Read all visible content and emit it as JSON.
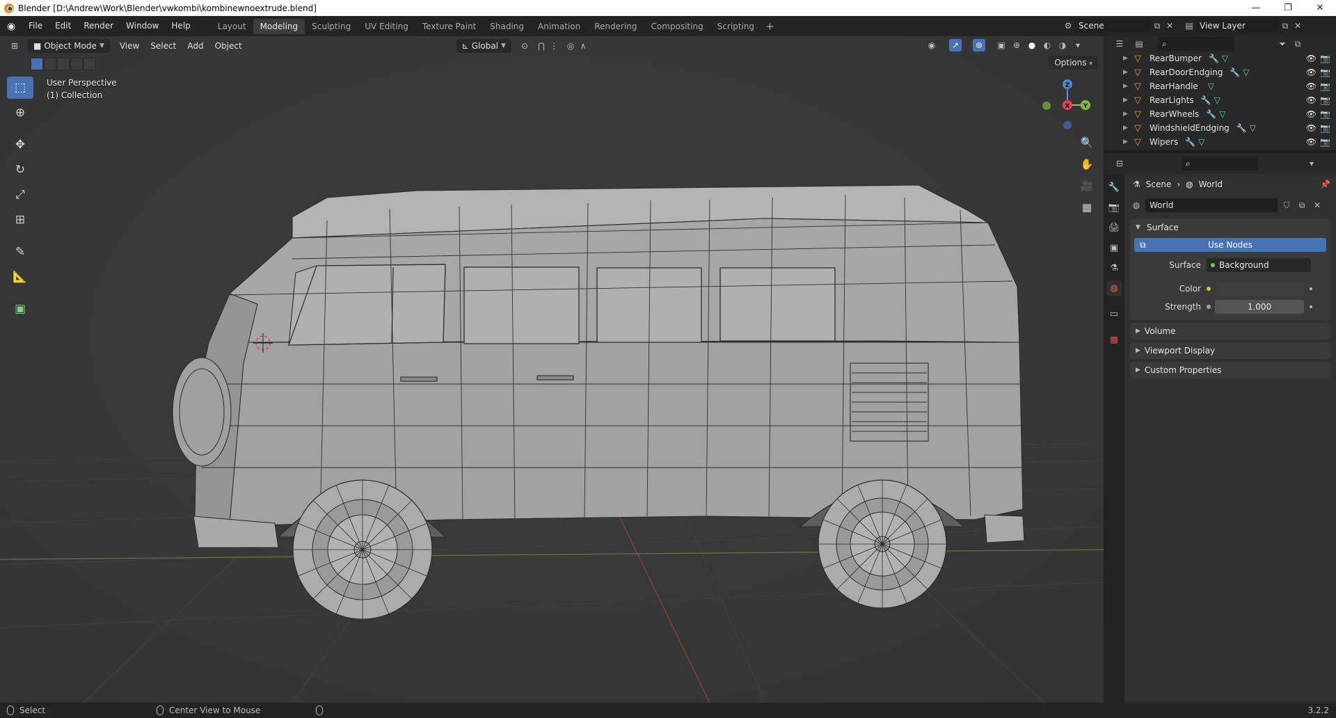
{
  "window": {
    "title": "Blender [D:\\Andrew\\Work\\Blender\\vwkombi\\kombinewnoextrude.blend]",
    "controls": [
      "—",
      "❐",
      "✕"
    ]
  },
  "topbar": {
    "menus": [
      "File",
      "Edit",
      "Render",
      "Window",
      "Help"
    ],
    "workspaces": [
      "Layout",
      "Modeling",
      "Sculpting",
      "UV Editing",
      "Texture Paint",
      "Shading",
      "Animation",
      "Rendering",
      "Compositing",
      "Scripting"
    ],
    "active_workspace": "Modeling",
    "add_tab": "+",
    "scene": "Scene",
    "view_layer": "View Layer"
  },
  "viewport": {
    "mode": "Object Mode",
    "menus": [
      "View",
      "Select",
      "Add",
      "Object"
    ],
    "transform_orientation": "Global",
    "options_label": "Options",
    "overlay_line1": "User Perspective",
    "overlay_line2": "(1) Collection",
    "gizmo_axes": {
      "x": "X",
      "y": "Y",
      "z": "Z"
    }
  },
  "outliner": {
    "rows": [
      {
        "name": "RearBumper"
      },
      {
        "name": "RearDoorEndging"
      },
      {
        "name": "RearHandle"
      },
      {
        "name": "RearLights"
      },
      {
        "name": "RearWheels"
      },
      {
        "name": "WindshieldEndging"
      },
      {
        "name": "Wipers"
      }
    ]
  },
  "properties": {
    "breadcrumb_scene": "Scene",
    "breadcrumb_world": "World",
    "world_name": "World",
    "surface_panel": "Surface",
    "use_nodes": "Use Nodes",
    "surface_label": "Surface",
    "surface_value": "Background",
    "color_label": "Color",
    "strength_label": "Strength",
    "strength_value": "1.000",
    "closed_panels": [
      "Volume",
      "Viewport Display",
      "Custom Properties"
    ],
    "colors": {
      "surface_dot": "#5fd15f",
      "color_dot": "#d8c63a",
      "strength_dot": "#a3a3a3",
      "accent": "#4772b3"
    }
  },
  "statusbar": {
    "select": "Select",
    "center_view": "Center View to Mouse",
    "version": "3.2.2"
  }
}
